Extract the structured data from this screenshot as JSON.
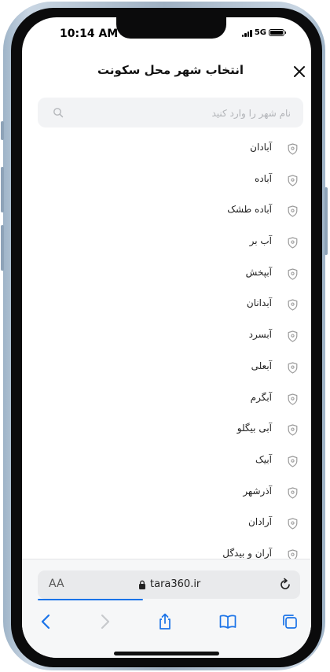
{
  "status_bar": {
    "time": "10:14 AM",
    "network": "5G"
  },
  "header": {
    "title": "انتخاب شهر محل سکونت",
    "close_icon": "close-icon"
  },
  "search": {
    "placeholder": "نام شهر را وارد کنید",
    "value": "",
    "icon": "search-icon"
  },
  "cities": [
    "آبادان",
    "آباده",
    "آباده طشک",
    "آب بر",
    "آبپخش",
    "آبدانان",
    "آبسرد",
    "آبعلی",
    "آبگرم",
    "آبی بیگلو",
    "آبیک",
    "آذرشهر",
    "آرادان",
    "آران و بیدگل"
  ],
  "browser": {
    "text_size_label": "AA",
    "url": "tara360.ir",
    "accent": "#1a73e8",
    "load_progress": 0.4
  },
  "colors": {
    "pin": "#9a9a9a",
    "toolbar_icons": "#1a73e8",
    "disabled_icon": "#c7c9cc"
  }
}
